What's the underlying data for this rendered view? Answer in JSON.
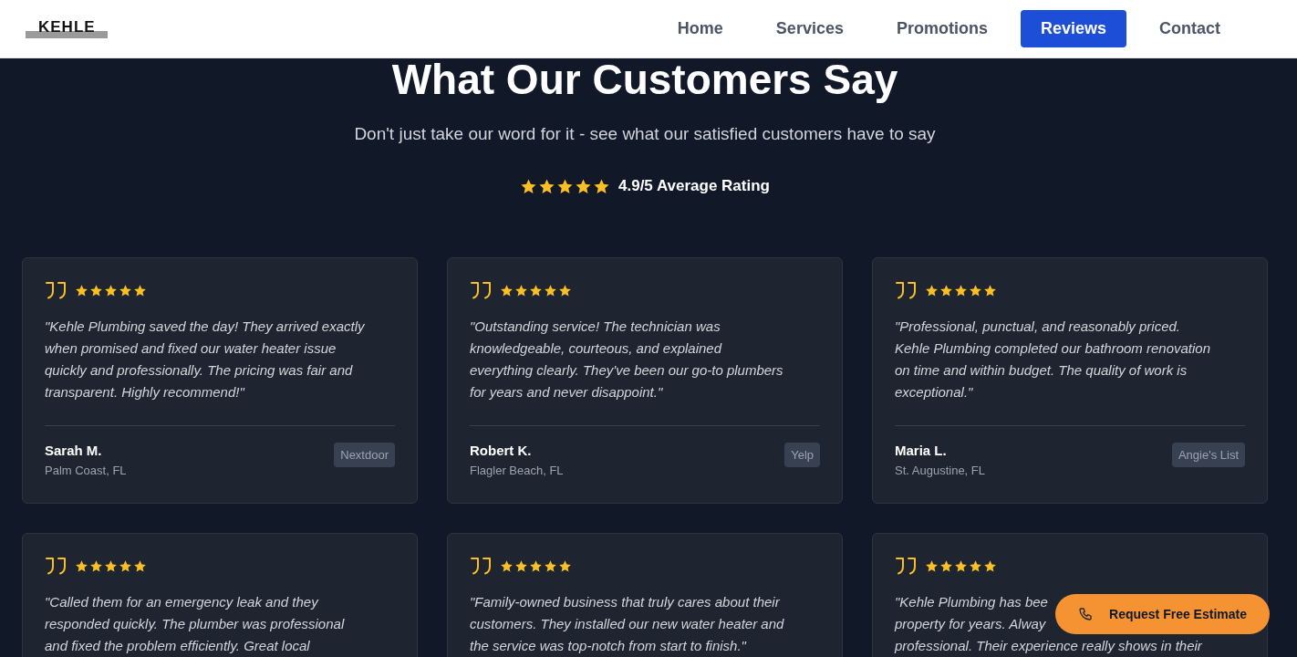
{
  "logo": {
    "text": "KEHLE"
  },
  "nav": [
    {
      "label": "Home",
      "selected": false
    },
    {
      "label": "Services",
      "selected": false
    },
    {
      "label": "Promotions",
      "selected": false
    },
    {
      "label": "Reviews",
      "selected": true
    },
    {
      "label": "Contact",
      "selected": false
    }
  ],
  "heading": "What Our Customers Say",
  "subheading": "Don't just take our word for it - see what our satisfied customers have to say",
  "average": {
    "stars": 5,
    "label": "4.9/5 Average Rating"
  },
  "reviews": [
    {
      "stars": 5,
      "lines": [
        "\"Kehle Plumbing saved the day! They arrived exactly",
        "when promised and fixed our water heater issue",
        "quickly and professionally. The pricing was fair and",
        "transparent. Highly recommend!\""
      ],
      "name": "Sarah M.",
      "location": "Palm Coast, FL",
      "source": "Nextdoor"
    },
    {
      "stars": 5,
      "lines": [
        "\"Outstanding service! The technician was",
        "knowledgeable, courteous, and explained",
        "everything clearly. They've been our go-to plumbers",
        "for years and never disappoint.\""
      ],
      "name": "Robert K.",
      "location": "Flagler Beach, FL",
      "source": "Yelp"
    },
    {
      "stars": 5,
      "lines": [
        "\"Professional, punctual, and reasonably priced.",
        "Kehle Plumbing completed our bathroom renovation",
        "on time and within budget. The quality of work is",
        "exceptional.\""
      ],
      "name": "Maria L.",
      "location": "St. Augustine, FL",
      "source": "Angie's List"
    },
    {
      "stars": 5,
      "lines": [
        "\"Called them for an emergency leak and they",
        "responded quickly. The plumber was professional",
        "and fixed the problem efficiently. Great local"
      ]
    },
    {
      "stars": 5,
      "lines": [
        "\"Family-owned business that truly cares about their",
        "customers. They installed our new water heater and",
        "the service was top-notch from start to finish.\""
      ]
    },
    {
      "stars": 5,
      "lines": [
        "\"Kehle Plumbing has bee",
        "property for years. Alway",
        "professional. Their experience really shows in their"
      ]
    }
  ],
  "cta": {
    "label": "Request Free Estimate"
  }
}
